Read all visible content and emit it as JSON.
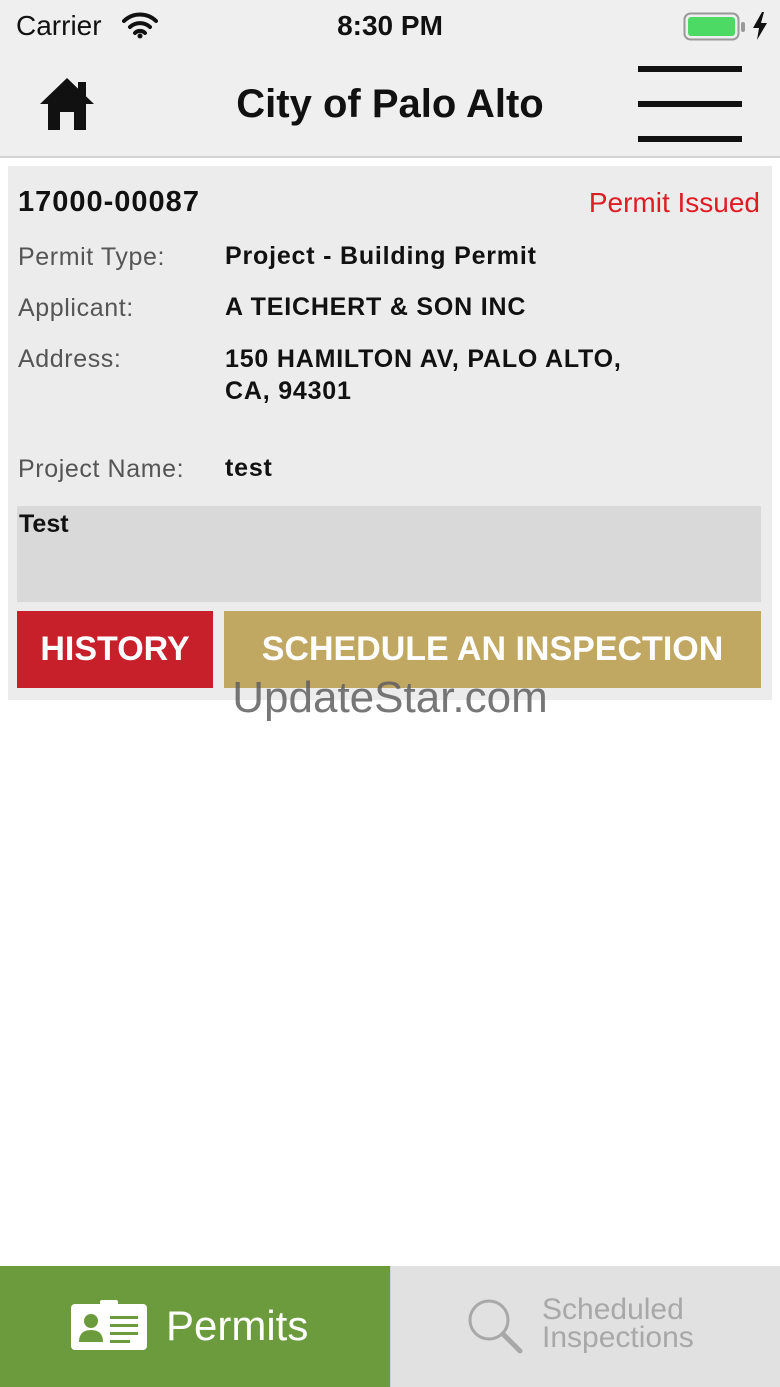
{
  "status_bar": {
    "carrier": "Carrier",
    "time": "8:30 PM",
    "icons": [
      "wifi-icon",
      "battery-icon",
      "charging-bolt-icon"
    ]
  },
  "nav": {
    "title": "City of Palo Alto",
    "left_icon": "home-icon",
    "right_icon": "hamburger-menu-icon"
  },
  "permit": {
    "number": "17000-00087",
    "status": "Permit Issued",
    "status_color": "#e01b24",
    "fields": {
      "permit_type_label": "Permit Type:",
      "permit_type_value": "Project - Building Permit",
      "applicant_label": "Applicant:",
      "applicant_value": "A TEICHERT & SON INC",
      "address_label": "Address:",
      "address_line1": "150 HAMILTON AV, PALO ALTO,",
      "address_line2": "CA, 94301",
      "project_name_label": "Project Name:",
      "project_name_value": "test"
    },
    "notes": "Test",
    "history_button": "HISTORY",
    "schedule_button": "SCHEDULE AN INSPECTION"
  },
  "watermark": "UpdateStar.com",
  "tabs": [
    {
      "label": "Permits",
      "icon": "id-card-icon",
      "active": true
    },
    {
      "label": "Scheduled Inspections",
      "line1": "Scheduled",
      "line2": "Inspections",
      "icon": "search-icon",
      "active": false
    }
  ],
  "colors": {
    "active_tab": "#6b9b3c",
    "history": "#c8202a",
    "schedule": "#c0a762"
  }
}
